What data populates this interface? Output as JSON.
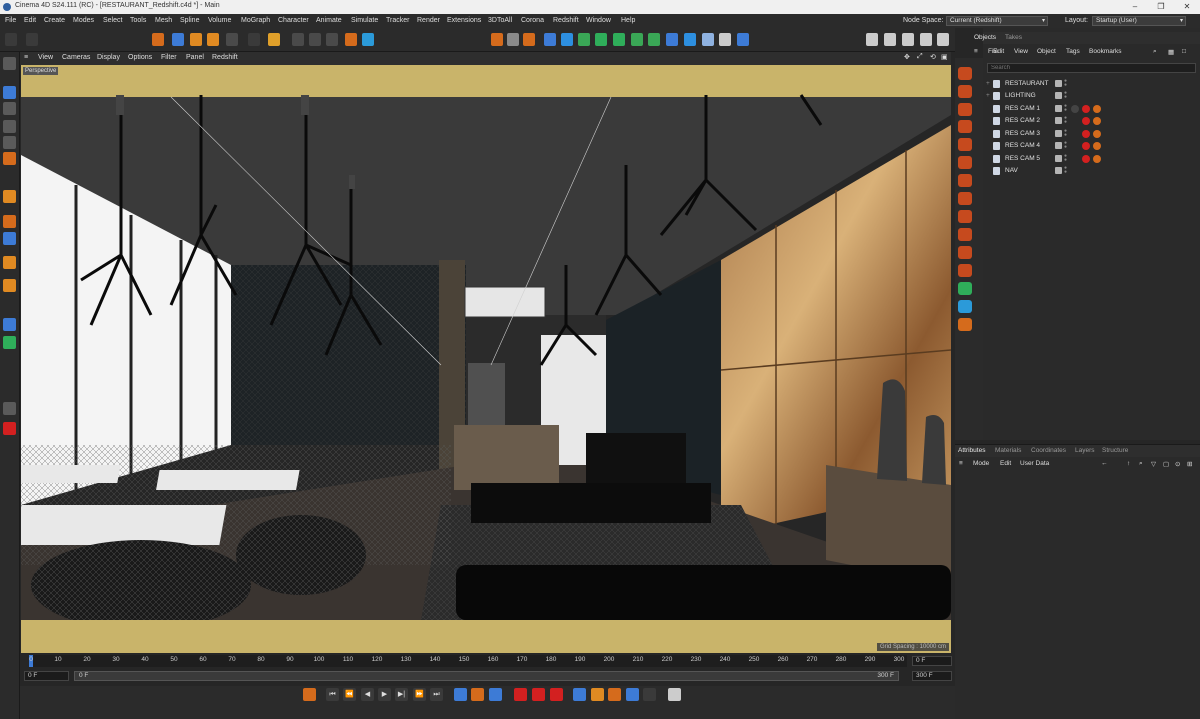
{
  "window": {
    "title": "Cinema 4D S24.111 (RC) - [RESTAURANT_Redshift.c4d *] - Main",
    "controls": [
      "–",
      "❐",
      "✕"
    ]
  },
  "menubar": {
    "items": [
      "File",
      "Edit",
      "Create",
      "Modes",
      "Select",
      "Tools",
      "Mesh",
      "Spline",
      "Volume",
      "MoGraph",
      "Character",
      "Animate",
      "Simulate",
      "Tracker",
      "Render",
      "Extensions",
      "3DToAll",
      "Corona",
      "Redshift",
      "Window",
      "Help"
    ],
    "node_space_label": "Node Space:",
    "node_space_value": "Current (Redshift)",
    "layout_label": "Layout:",
    "layout_value": "Startup (User)"
  },
  "viewport": {
    "menu": [
      "View",
      "Cameras",
      "Display",
      "Options",
      "Filter",
      "Panel",
      "Redshift"
    ],
    "camera_label": "Perspective",
    "grid_spacing": "Grid Spacing : 10000 cm"
  },
  "timeline": {
    "ticks": [
      "0",
      "10",
      "20",
      "30",
      "40",
      "50",
      "60",
      "70",
      "80",
      "90",
      "100",
      "110",
      "120",
      "130",
      "140",
      "150",
      "160",
      "170",
      "180",
      "190",
      "200",
      "210",
      "220",
      "230",
      "240",
      "250",
      "260",
      "270",
      "280",
      "290",
      "300"
    ],
    "current_frame": "0 F",
    "start_field": "0 F",
    "range_start": "0 F",
    "range_end": "300 F",
    "end_field": "300 F",
    "end_field2": "300 F"
  },
  "objects_panel": {
    "tabs": [
      "Objects",
      "Takes"
    ],
    "menu": [
      "File",
      "Edit",
      "View",
      "Object",
      "Tags",
      "Bookmarks"
    ],
    "search_placeholder": "Search",
    "items": [
      {
        "name": "RESTAURANT",
        "type": "group"
      },
      {
        "name": "LIGHTING",
        "type": "group"
      },
      {
        "name": "RES CAM 1",
        "type": "camera"
      },
      {
        "name": "RES CAM 2",
        "type": "camera"
      },
      {
        "name": "RES CAM 3",
        "type": "camera"
      },
      {
        "name": "RES CAM 4",
        "type": "camera"
      },
      {
        "name": "RES CAM 5",
        "type": "camera"
      },
      {
        "name": "NAV",
        "type": "camera"
      }
    ]
  },
  "attributes_panel": {
    "tabs": [
      "Attributes",
      "Materials",
      "Coordinates",
      "Layers",
      "Structure"
    ],
    "menu": [
      "Mode",
      "Edit",
      "User Data"
    ]
  },
  "colors": {
    "accent": "#3d7bd6",
    "brand_orange": "#d4561c",
    "tag_red": "#d32020",
    "ceiling_band": "#c9b46a"
  }
}
